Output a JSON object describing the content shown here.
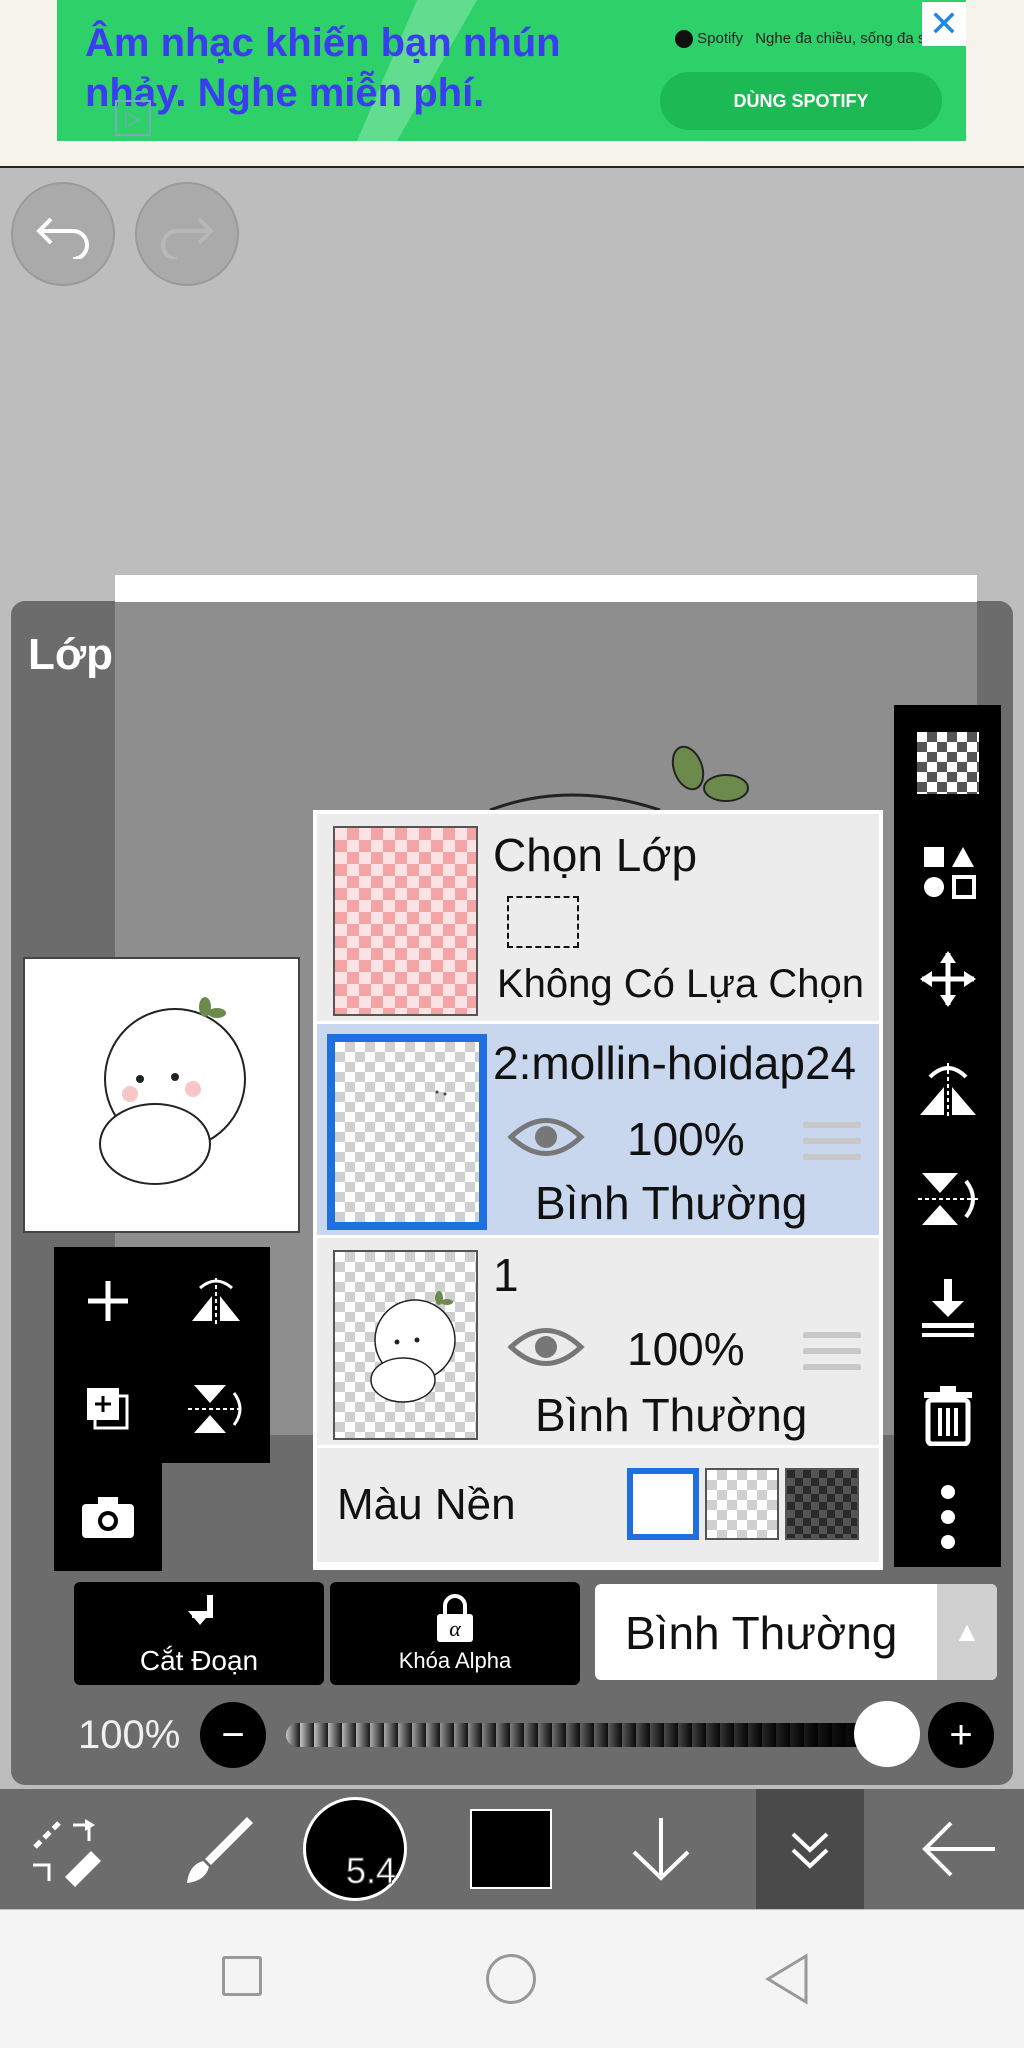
{
  "ad": {
    "headline": "Âm nhạc khiến bạn nhún nhảy. Nghe miễn phí.",
    "brand": "Spotify",
    "brand_tagline": "Nghe đa chiều, sống đa s",
    "cta": "DÙNG SPOTIFY",
    "close_icon": "close-icon",
    "colors": {
      "banner": "#2ed06a",
      "headline": "#3b3df0",
      "cta": "#1db954"
    }
  },
  "history": {
    "undo_icon": "undo-icon",
    "redo_icon": "redo-icon"
  },
  "layer_panel": {
    "title": "Lớp",
    "selection_row": {
      "title": "Chọn Lớp",
      "subtitle": "Không Có Lựa Chọn"
    },
    "layers": [
      {
        "name": "2:mollin-hoidap24",
        "opacity": "100%",
        "blend": "Bình Thường",
        "selected": true,
        "visible": true
      },
      {
        "name": "1",
        "opacity": "100%",
        "blend": "Bình Thường",
        "selected": false,
        "visible": true
      }
    ],
    "background": {
      "label": "Màu Nền",
      "options": [
        "white",
        "transparent",
        "dark"
      ],
      "selected": "white"
    },
    "left_tools": [
      "add-layer-icon",
      "flip-horizontal-icon",
      "add-copy-icon",
      "flip-vertical-icon",
      "camera-icon"
    ],
    "right_tools": [
      "transparency-icon",
      "transform-swap-icon",
      "move-icon",
      "flip-h-icon",
      "flip-v-icon",
      "merge-down-icon",
      "trash-icon",
      "more-icon"
    ]
  },
  "controls": {
    "clip_label": "Cắt Đoạn",
    "alpha_label": "Khóa Alpha",
    "blend_mode": "Bình Thường",
    "opacity_label": "100%",
    "opacity_value": 1.0
  },
  "toolbar": {
    "brush_size": "5.4",
    "color": "#000000",
    "items": [
      "transform-icon",
      "brush-icon",
      "brush-size",
      "color-swatch",
      "arrow-down-icon",
      "collapse-icon",
      "back-arrow-icon"
    ]
  },
  "nav": {
    "items": [
      "recent-apps-icon",
      "home-icon",
      "back-icon"
    ]
  }
}
